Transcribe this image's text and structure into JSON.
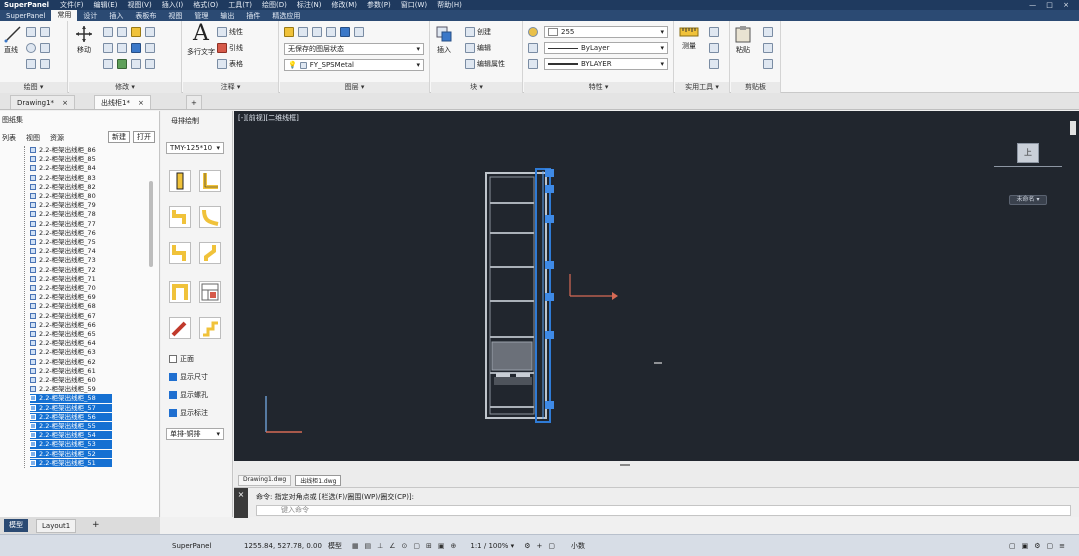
{
  "menubar": {
    "app": "SuperPanel",
    "tabs": [
      "文件(F)",
      "编辑(E)",
      "视图(V)",
      "插入(I)",
      "格式(O)",
      "工具(T)",
      "绘图(D)",
      "标注(N)",
      "修改(M)",
      "参数(P)",
      "窗口(W)",
      "帮助(H)"
    ],
    "ribbon_tabs": [
      "常用",
      "设计",
      "插入",
      "表板布",
      "视图",
      "管理",
      "输出",
      "插件",
      "精选应用"
    ],
    "active_ribbon_tab": "常用",
    "window_controls": "— □ ×"
  },
  "ribbon": {
    "draw": {
      "title": "绘图 ▾",
      "line": "直线"
    },
    "modify": {
      "title": "修改 ▾",
      "move": "移动"
    },
    "annotation": {
      "title": "注释 ▾",
      "text": "多行文字",
      "linear": "线性",
      "leader": "引线",
      "table": "表格"
    },
    "layers": {
      "title": "图层 ▾",
      "layer_prop": "图层特性",
      "current_layer": "无保存的图层状态",
      "layer_name": "FY_SPSMetal"
    },
    "block": {
      "title": "块 ▾",
      "insert": "插入",
      "create": "创建",
      "edit": "编辑",
      "edit_attr": "编辑属性"
    },
    "properties": {
      "title": "特性 ▾",
      "color": "255",
      "linetype": "ByLayer",
      "lineweight": "BYLAYER"
    },
    "utilities": {
      "title": "实用工具 ▾",
      "measure": "测量"
    },
    "clipboard": {
      "title": "剪贴板",
      "paste": "粘贴"
    }
  },
  "doctabs": [
    {
      "label": "Drawing1*",
      "active": false
    },
    {
      "label": "出线柜1*",
      "active": true
    }
  ],
  "sheets": {
    "title": "图纸集",
    "tabs": [
      "列表",
      "视图",
      "资源"
    ],
    "actions": [
      "新建",
      "打开"
    ],
    "items": [
      "2.2-柜架出线柜_86",
      "2.2-柜架出线柜_85",
      "2.2-柜架出线柜_84",
      "2.2-柜架出线柜_83",
      "2.2-柜架出线柜_82",
      "2.2-柜架出线柜_80",
      "2.2-柜架出线柜_79",
      "2.2-柜架出线柜_78",
      "2.2-柜架出线柜_77",
      "2.2-柜架出线柜_76",
      "2.2-柜架出线柜_75",
      "2.2-柜架出线柜_74",
      "2.2-柜架出线柜_73",
      "2.2-柜架出线柜_72",
      "2.2-柜架出线柜_71",
      "2.2-柜架出线柜_70",
      "2.2-柜架出线柜_69",
      "2.2-柜架出线柜_68",
      "2.2-柜架出线柜_67",
      "2.2-柜架出线柜_66",
      "2.2-柜架出线柜_65",
      "2.2-柜架出线柜_64",
      "2.2-柜架出线柜_63",
      "2.2-柜架出线柜_62",
      "2.2-柜架出线柜_61",
      "2.2-柜架出线柜_60",
      "2.2-柜架出线柜_59",
      "2.2-柜架出线柜_58",
      "2.2-柜架出线柜_57",
      "2.2-柜架出线柜_56",
      "2.2-柜架出线柜_55",
      "2.2-柜架出线柜_54",
      "2.2-柜架出线柜_53",
      "2.2-柜架出线柜_52",
      "2.2-柜架出线柜_51"
    ],
    "selected_from": 27
  },
  "palette": {
    "title": "母排绘制",
    "spec": "TMY-125*10",
    "options": [
      {
        "label": "正面",
        "checked": false
      },
      {
        "label": "显示尺寸",
        "checked": true
      },
      {
        "label": "显示螺孔",
        "checked": true
      },
      {
        "label": "显示标注",
        "checked": true
      }
    ],
    "mode": "单排-铜排"
  },
  "canvas": {
    "viewport_label": "[-][前视][二维线框]",
    "viewcube": "上",
    "nav": "未命名 ▾"
  },
  "modeltabs": [
    "Drawing1.dwg",
    "出线柜1.dwg"
  ],
  "command": {
    "history": "命令: 指定对角点或 [栏选(F)/圈围(WP)/圈交(CP)]:",
    "placeholder": "键入命令"
  },
  "layouttabs": [
    "模型",
    "Layout1"
  ],
  "statusbar": {
    "app": "SuperPanel",
    "coords": "1255.84, 527.78, 0.00",
    "mode": "模型",
    "scale": "1:1 / 100% ▾",
    "units": "小数"
  },
  "colors": {
    "canvas_bg": "#21262e",
    "selection": "#1570d2",
    "accent": "#3b78c8"
  }
}
